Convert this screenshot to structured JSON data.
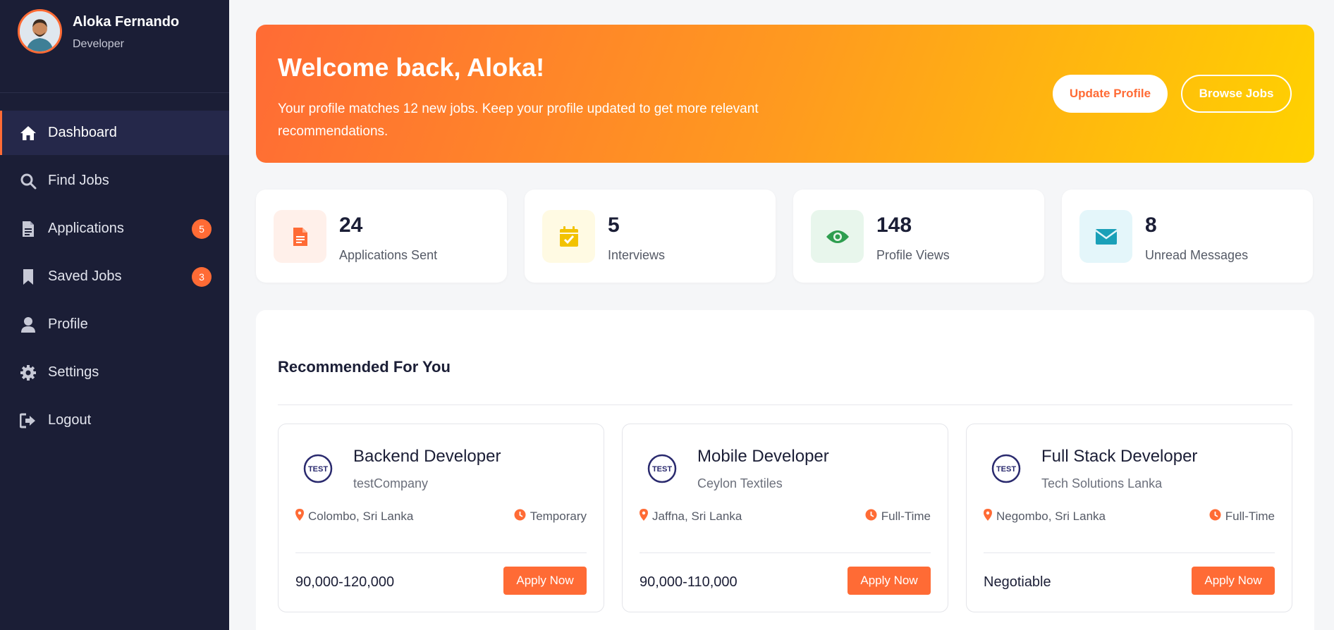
{
  "user": {
    "name": "Aloka Fernando",
    "role": "Developer"
  },
  "sidebar": {
    "items": [
      {
        "label": "Dashboard",
        "icon": "home-icon",
        "active": true
      },
      {
        "label": "Find Jobs",
        "icon": "search-icon"
      },
      {
        "label": "Applications",
        "icon": "document-icon",
        "badge": "5"
      },
      {
        "label": "Saved Jobs",
        "icon": "bookmark-icon",
        "badge": "3"
      },
      {
        "label": "Profile",
        "icon": "user-icon"
      },
      {
        "label": "Settings",
        "icon": "gear-icon"
      },
      {
        "label": "Logout",
        "icon": "logout-icon"
      }
    ]
  },
  "hero": {
    "title": "Welcome back, Aloka!",
    "subtitle": "Your profile matches 12 new jobs. Keep your profile updated to get more relevant recommendations.",
    "update_label": "Update Profile",
    "browse_label": "Browse Jobs"
  },
  "stats": [
    {
      "value": "24",
      "label": "Applications Sent",
      "icon": "document-icon",
      "color": "#ff6b35",
      "bg": "#fff0ea"
    },
    {
      "value": "5",
      "label": "Interviews",
      "icon": "calendar-check-icon",
      "color": "#f2c200",
      "bg": "#fffae3"
    },
    {
      "value": "148",
      "label": "Profile Views",
      "icon": "eye-icon",
      "color": "#2e9e4f",
      "bg": "#e8f6ec"
    },
    {
      "value": "8",
      "label": "Unread Messages",
      "icon": "envelope-icon",
      "color": "#1aa0b8",
      "bg": "#e4f6fa"
    }
  ],
  "recommended": {
    "title": "Recommended For You",
    "jobs": [
      {
        "logo_text": "TEST",
        "title": "Backend Developer",
        "company": "testCompany",
        "location": "Colombo, Sri Lanka",
        "type": "Temporary",
        "salary": "90,000-120,000",
        "apply_label": "Apply Now"
      },
      {
        "logo_text": "TEST",
        "title": "Mobile Developer",
        "company": "Ceylon Textiles",
        "location": "Jaffna, Sri Lanka",
        "type": "Full-Time",
        "salary": "90,000-110,000",
        "apply_label": "Apply Now"
      },
      {
        "logo_text": "TEST",
        "title": "Full Stack Developer",
        "company": "Tech Solutions Lanka",
        "location": "Negombo, Sri Lanka",
        "type": "Full-Time",
        "salary": "Negotiable",
        "apply_label": "Apply Now"
      }
    ]
  },
  "colors": {
    "accent": "#ff6b35",
    "sidebar": "#1b1e36",
    "logo": "#2a2a6e"
  }
}
